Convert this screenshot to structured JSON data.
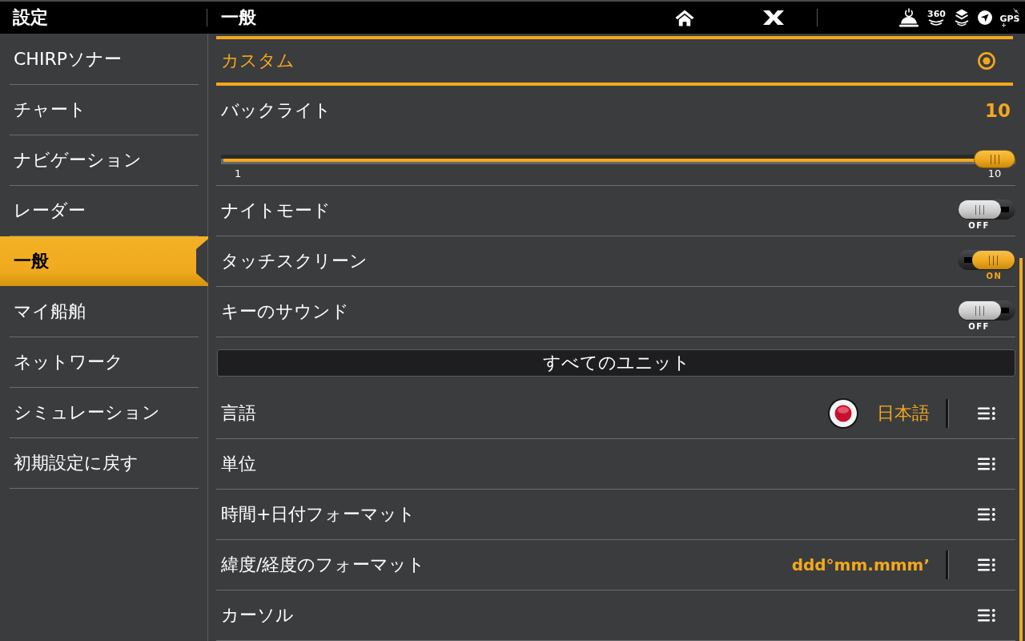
{
  "header": {
    "title": "設定",
    "page_title": "一般",
    "status_icons": [
      {
        "kind": "sonar"
      },
      {
        "kind": "sonar360",
        "label": "360"
      },
      {
        "kind": "imaging"
      },
      {
        "kind": "navigation"
      },
      {
        "kind": "gps",
        "label": "GPS"
      }
    ]
  },
  "sidebar": {
    "items": [
      {
        "label": "CHIRPソナー",
        "selected": false
      },
      {
        "label": "チャート",
        "selected": false
      },
      {
        "label": "ナビゲーション",
        "selected": false
      },
      {
        "label": "レーダー",
        "selected": false
      },
      {
        "label": "一般",
        "selected": true
      },
      {
        "label": "マイ船舶",
        "selected": false
      },
      {
        "label": "ネットワーク",
        "selected": false
      },
      {
        "label": "シミュレーション",
        "selected": false
      },
      {
        "label": "初期設定に戻す",
        "selected": false
      }
    ]
  },
  "settings": {
    "rows": [
      {
        "kind": "radio",
        "label": "カスタム",
        "selected": true
      },
      {
        "kind": "slider",
        "label": "バックライト",
        "value": "10",
        "level": 1,
        "min_label": "1",
        "max_label": "10"
      },
      {
        "kind": "toggle",
        "label": "ナイトモード",
        "on": false,
        "state_label": "OFF"
      },
      {
        "kind": "toggle",
        "label": "タッチスクリーン",
        "on": true,
        "state_label": "ON"
      },
      {
        "kind": "toggle",
        "label": "キーのサウンド",
        "on": false,
        "state_label": "OFF"
      },
      {
        "kind": "section",
        "label": "すべてのユニット"
      },
      {
        "kind": "language",
        "label": "言語",
        "value": "日本語"
      },
      {
        "kind": "menu",
        "label": "単位"
      },
      {
        "kind": "menu",
        "label": "時間+日付フォーマット"
      },
      {
        "kind": "menu",
        "label": "緯度/経度のフォーマット",
        "value": "ddd°mm.mmm’"
      },
      {
        "kind": "menu",
        "label": "カーソル"
      }
    ]
  }
}
